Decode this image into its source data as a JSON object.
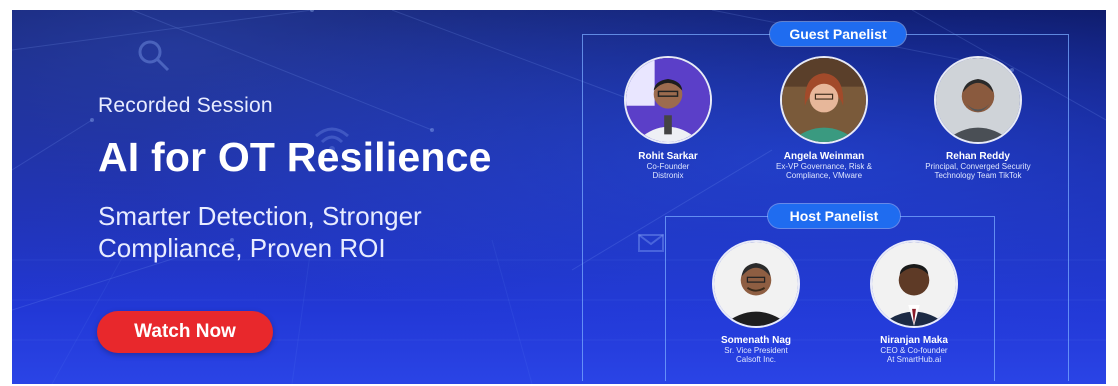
{
  "session": {
    "eyebrow": "Recorded Session",
    "title": "AI for OT Resilience",
    "subtitle": "Smarter Detection, Stronger Compliance, Proven ROI",
    "cta_label": "Watch Now"
  },
  "guest": {
    "label": "Guest Panelist",
    "panelists": [
      {
        "name": "Rohit Sarkar",
        "role_line1": "Co-Founder",
        "role_line2": "Distronix"
      },
      {
        "name": "Angela Weinman",
        "role_line1": "Ex-VP Governance, Risk &",
        "role_line2": "Compliance, VMware"
      },
      {
        "name": "Rehan Reddy",
        "role_line1": "Principal, Converged Security",
        "role_line2": "Technology Team TikTok"
      }
    ]
  },
  "host": {
    "label": "Host Panelist",
    "panelists": [
      {
        "name": "Somenath Nag",
        "role_line1": "Sr. Vice President",
        "role_line2": "Calsoft Inc."
      },
      {
        "name": "Niranjan Maka",
        "role_line1": "CEO & Co-founder",
        "role_line2": "At SmartHub.ai"
      }
    ]
  },
  "colors": {
    "cta": "#e8282c",
    "pill": "#1f6cf0",
    "background_top": "#0e1a66",
    "background_bottom": "#2a44e6"
  },
  "icons": [
    "search-icon",
    "wifi-icon",
    "envelope-icon",
    "network-lines"
  ]
}
